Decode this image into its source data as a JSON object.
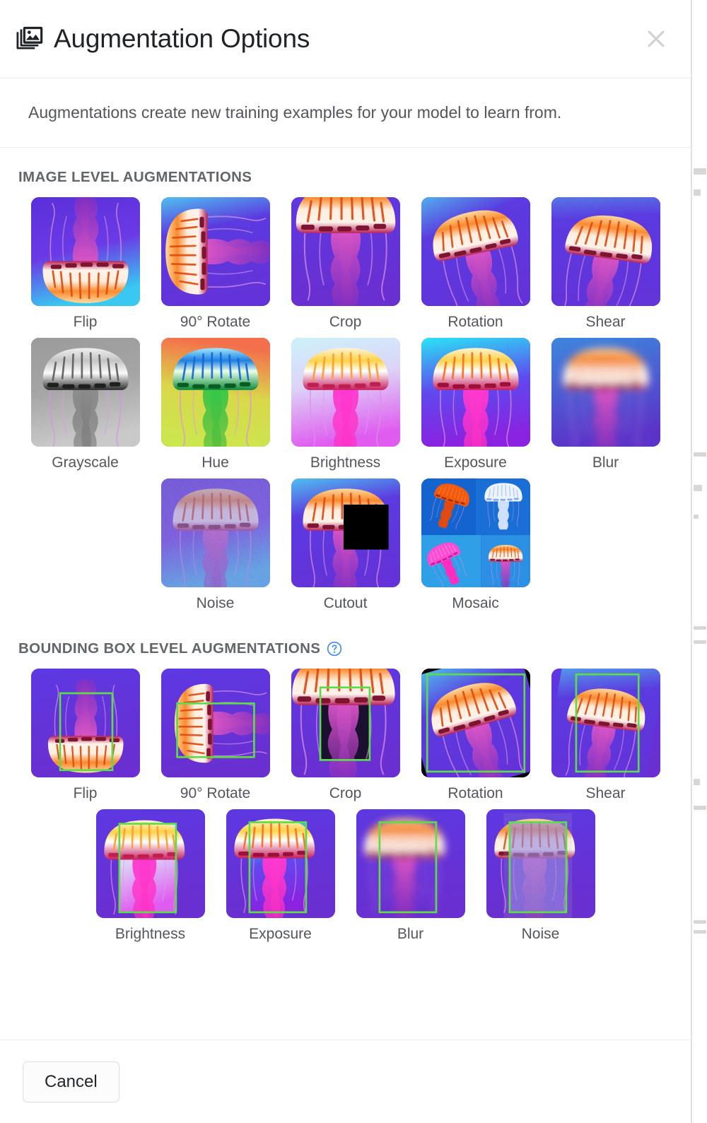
{
  "dialog": {
    "title": "Augmentation Options",
    "title_icon": "collections-icon",
    "close_icon": "close-icon",
    "subtitle": "Augmentations create new training examples for your model to learn from."
  },
  "sections": [
    {
      "id": "image-level",
      "heading": "IMAGE LEVEL AUGMENTATIONS",
      "has_help": false,
      "rows": [
        [
          {
            "label": "Flip",
            "style": "flip"
          },
          {
            "label": "90° Rotate",
            "style": "rotate90"
          },
          {
            "label": "Crop",
            "style": "crop"
          },
          {
            "label": "Rotation",
            "style": "rotation"
          },
          {
            "label": "Shear",
            "style": "shear"
          }
        ],
        [
          {
            "label": "Grayscale",
            "style": "grayscale"
          },
          {
            "label": "Hue",
            "style": "hue"
          },
          {
            "label": "Brightness",
            "style": "brightness"
          },
          {
            "label": "Exposure",
            "style": "exposure"
          },
          {
            "label": "Blur",
            "style": "blur"
          }
        ],
        [
          {
            "label": "Noise",
            "style": "noise"
          },
          {
            "label": "Cutout",
            "style": "cutout"
          },
          {
            "label": "Mosaic",
            "style": "mosaic"
          }
        ]
      ]
    },
    {
      "id": "bbox-level",
      "heading": "BOUNDING BOX LEVEL AUGMENTATIONS",
      "has_help": true,
      "help_icon": "help-circle-icon",
      "rows": [
        [
          {
            "label": "Flip",
            "style": "bb-flip"
          },
          {
            "label": "90° Rotate",
            "style": "bb-rotate90"
          },
          {
            "label": "Crop",
            "style": "bb-crop"
          },
          {
            "label": "Rotation",
            "style": "bb-rotation"
          },
          {
            "label": "Shear",
            "style": "bb-shear"
          }
        ],
        [
          {
            "label": "Brightness",
            "style": "bb-brightness"
          },
          {
            "label": "Exposure",
            "style": "bb-exposure"
          },
          {
            "label": "Blur",
            "style": "bb-blur"
          },
          {
            "label": "Noise",
            "style": "bb-noise"
          }
        ]
      ]
    }
  ],
  "footer": {
    "cancel_label": "Cancel"
  },
  "colors": {
    "bbox_outline": "#5ddc4a",
    "help_icon": "#3f8ce8",
    "heading_text": "#636669",
    "label_text": "#53565c",
    "title_text": "#1f2328",
    "thumb_bg_purple": "#5b33d6",
    "thumb_bg_cyan": "#3fc3f0",
    "cutout_black": "#000000"
  }
}
